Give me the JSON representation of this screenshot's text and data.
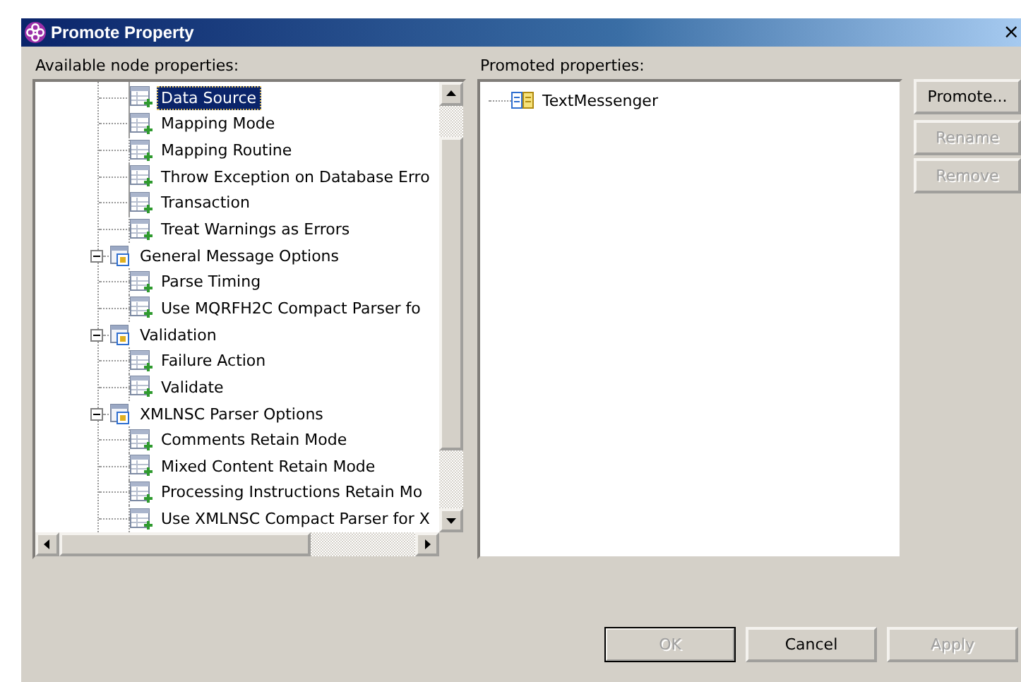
{
  "window": {
    "title": "Promote Property",
    "close": "×"
  },
  "available": {
    "label": "Available node properties:",
    "items": [
      {
        "expanded": true,
        "children": [
          {
            "label": "Data Source",
            "selected": true
          },
          {
            "label": "Mapping Mode",
            "selected": false
          },
          {
            "label": "Mapping Routine",
            "selected": false
          },
          {
            "label": "Throw Exception on Database Erro",
            "selected": false
          },
          {
            "label": "Transaction",
            "selected": false
          },
          {
            "label": "Treat Warnings as Errors",
            "selected": false
          }
        ]
      },
      {
        "label": "General Message Options",
        "expanded": true,
        "selected": false,
        "children": [
          {
            "label": "Parse Timing",
            "selected": false
          },
          {
            "label": "Use MQRFH2C Compact Parser fo",
            "selected": false
          }
        ]
      },
      {
        "label": "Validation",
        "expanded": true,
        "selected": false,
        "children": [
          {
            "label": "Failure Action",
            "selected": false
          },
          {
            "label": "Validate",
            "selected": false
          }
        ]
      },
      {
        "label": "XMLNSC Parser Options",
        "expanded": true,
        "selected": false,
        "children": [
          {
            "label": "Comments Retain Mode",
            "selected": false
          },
          {
            "label": "Mixed Content Retain Mode",
            "selected": false
          },
          {
            "label": "Processing Instructions Retain Mo",
            "selected": false
          },
          {
            "label": "Use XMLNSC Compact Parser for X",
            "selected": false
          }
        ]
      }
    ]
  },
  "promoted": {
    "label": "Promoted properties:",
    "items": [
      {
        "label": "TextMessenger"
      }
    ]
  },
  "side_buttons": [
    {
      "label": "Promote...",
      "disabled": false
    },
    {
      "label": "Rename",
      "disabled": true
    },
    {
      "label": "Remove",
      "disabled": true
    }
  ],
  "buttons": [
    {
      "label": "OK",
      "disabled": true,
      "default": true
    },
    {
      "label": "Cancel",
      "disabled": false,
      "default": false
    },
    {
      "label": "Apply",
      "disabled": true,
      "default": false
    }
  ]
}
